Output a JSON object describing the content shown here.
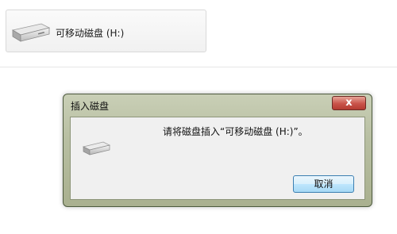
{
  "explorer": {
    "drive_label": "可移动磁盘 (H:)",
    "drive_icon": "usb-drive-icon"
  },
  "dialog": {
    "title": "插入磁盘",
    "close_glyph": "x",
    "message": "请将磁盘插入“可移动磁盘 (H:)”。",
    "icon": "usb-drive-icon",
    "cancel_label": "取消"
  }
}
